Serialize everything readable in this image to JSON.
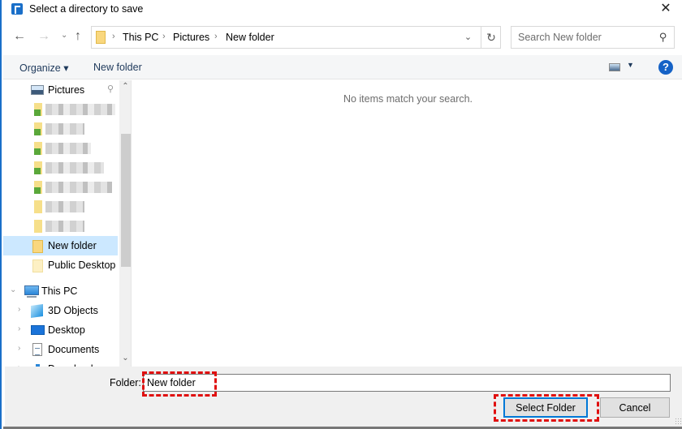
{
  "window": {
    "title": "Select a directory to save",
    "close_glyph": "✕"
  },
  "nav": {
    "back_glyph": "←",
    "forward_glyph": "→",
    "recent_glyph": "⌄",
    "up_glyph": "↑",
    "breadcrumb": [
      "This PC",
      "Pictures",
      "New folder"
    ],
    "breadcrumb_sep": "›",
    "dropdown_glyph": "⌄",
    "refresh_glyph": "↻"
  },
  "search": {
    "placeholder": "Search New folder",
    "icon_glyph": "⚲"
  },
  "toolbar": {
    "organize_label": "Organize ▾",
    "new_folder_label": "New folder",
    "view_dd_glyph": "▼",
    "help_glyph": "?"
  },
  "navpane": {
    "quick_access_pinned": {
      "label": "Pictures",
      "pin_glyph": "📌"
    },
    "blurred_items_count": 7,
    "items": [
      {
        "label": "New folder",
        "selected": true
      },
      {
        "label": "Public Desktop",
        "selected": false
      }
    ],
    "this_pc": {
      "label": "This PC",
      "expanded": true,
      "children": [
        "3D Objects",
        "Desktop",
        "Documents",
        "Downloads"
      ]
    },
    "expand_glyph": "›",
    "collapse_glyph": "⌄",
    "scroll_up_glyph": "⌃",
    "scroll_down_glyph": "⌄"
  },
  "content": {
    "empty_message": "No items match your search."
  },
  "footer": {
    "folder_label": "Folder:",
    "folder_value": "New folder",
    "select_button": "Select Folder",
    "cancel_button": "Cancel"
  },
  "colors": {
    "accent": "#0078d7",
    "selection": "#cce8ff",
    "highlight_annotation": "#e01010"
  }
}
